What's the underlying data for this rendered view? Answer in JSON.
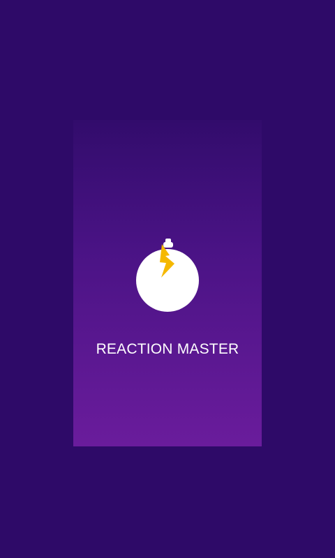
{
  "splash": {
    "title": "REACTION MASTER",
    "logo_icon": "stopwatch-lightning-icon"
  },
  "colors": {
    "background": "#2E0A68",
    "card_top": "#320C6C",
    "card_bottom": "#6A1C9C",
    "logo_circle": "#FFFFFF",
    "bolt": "#F5B800",
    "title_text": "#FFFFFF"
  }
}
